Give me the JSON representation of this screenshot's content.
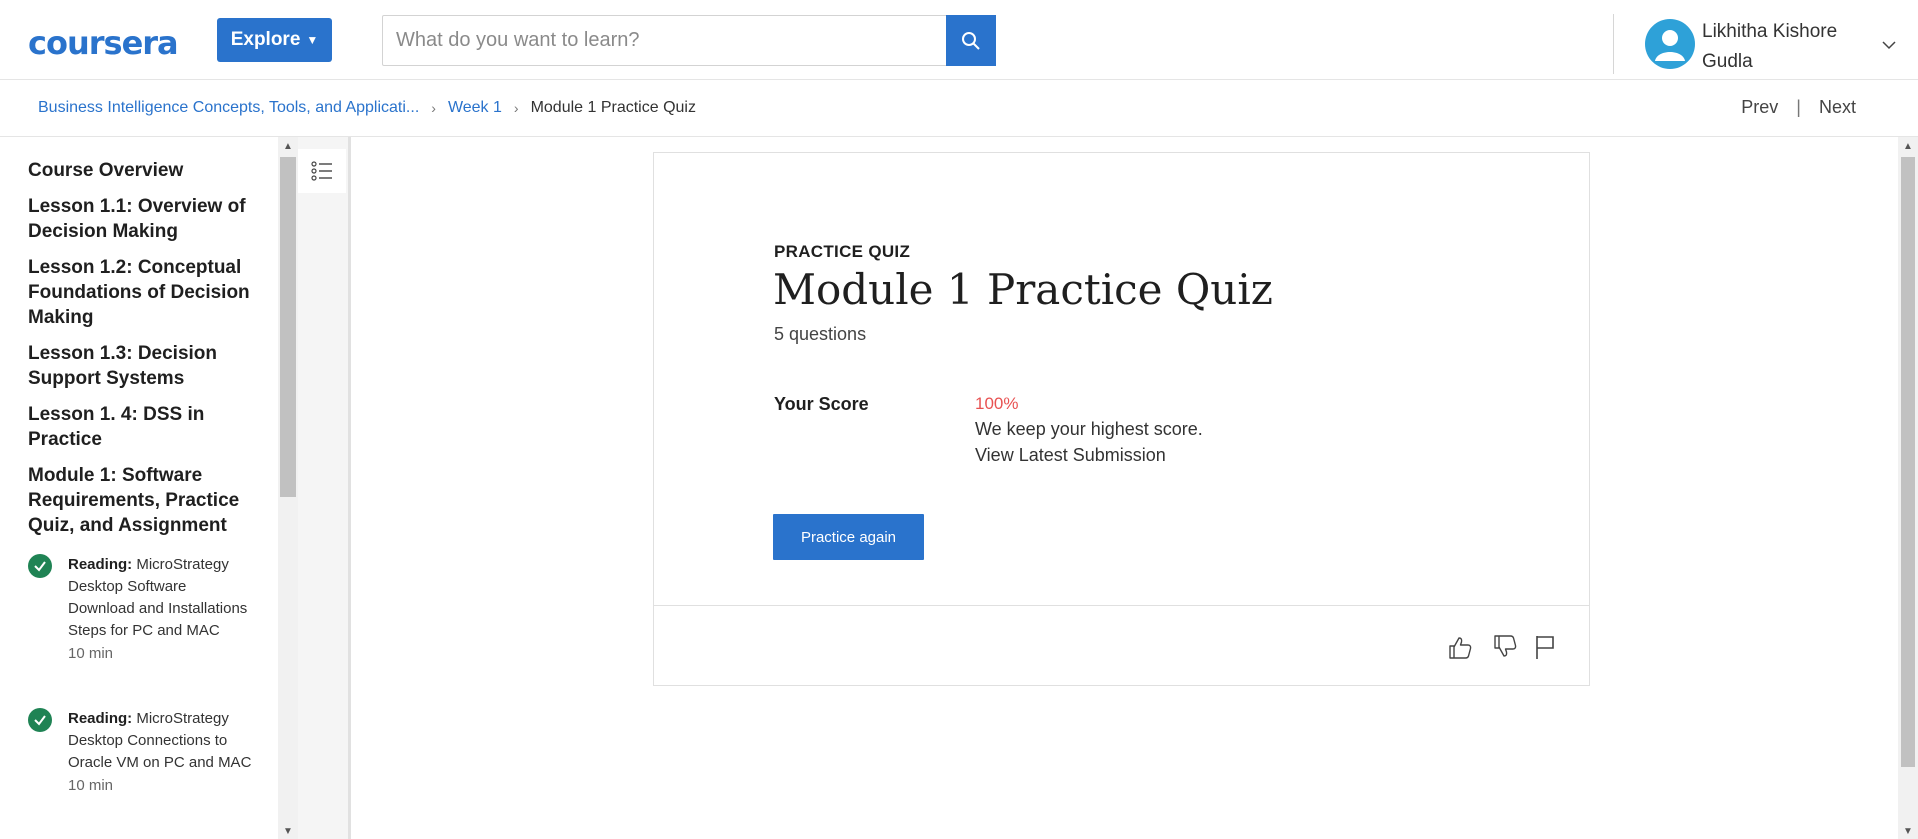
{
  "header": {
    "logo_text": "coursera",
    "explore_label": "Explore",
    "search_placeholder": "What do you want to learn?",
    "user_name": "Likhitha Kishore Gudla"
  },
  "breadcrumb": {
    "course": "Business Intelligence Concepts, Tools, and Applicati...",
    "week": "Week 1",
    "current": "Module 1 Practice Quiz",
    "prev_label": "Prev",
    "next_label": "Next"
  },
  "sidebar": {
    "modules": [
      "Course Overview",
      "Lesson 1.1: Overview of Decision Making",
      "Lesson 1.2: Conceptual Foundations of Decision Making",
      "Lesson 1.3: Decision Support Systems",
      "Lesson 1. 4: DSS in Practice",
      "Module 1: Software Requirements, Practice Quiz, and Assignment"
    ],
    "items": [
      {
        "type": "Reading:",
        "title": "MicroStrategy Desktop Software Download and Installations Steps for PC and MAC",
        "duration": "10 min",
        "completed": true
      },
      {
        "type": "Reading:",
        "title": "MicroStrategy Desktop Connections to Oracle VM on PC and MAC",
        "duration": "10 min",
        "completed": true
      }
    ]
  },
  "quiz": {
    "kind_label": "PRACTICE QUIZ",
    "title": "Module 1 Practice Quiz",
    "question_count": "5 questions",
    "score_label": "Your Score",
    "score_value": "100%",
    "score_note": "We keep your highest score.",
    "view_submission_label": "View Latest Submission",
    "practice_again_label": "Practice again"
  },
  "colors": {
    "brand_blue": "#2a73cc",
    "score_red": "#e85252",
    "complete_green": "#1f8354"
  }
}
